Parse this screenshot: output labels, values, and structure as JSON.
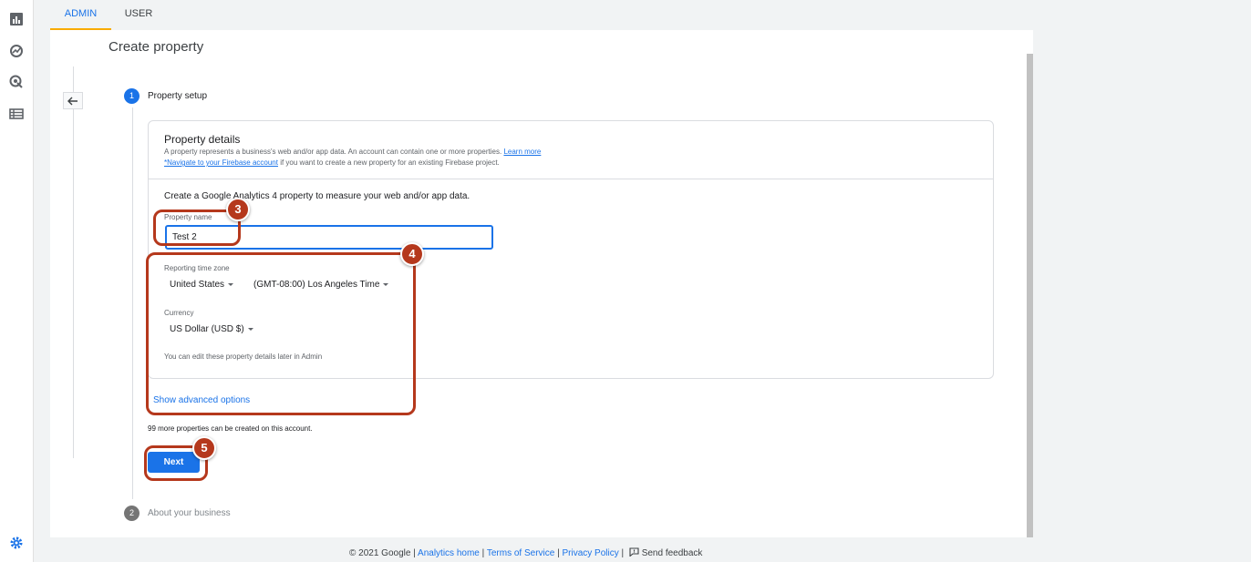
{
  "tabs": [
    {
      "label": "ADMIN"
    },
    {
      "label": "USER"
    }
  ],
  "page_title": "Create property",
  "steps": [
    {
      "number": "1",
      "label": "Property setup"
    },
    {
      "number": "2",
      "label": "About your business"
    }
  ],
  "details": {
    "title": "Property details",
    "desc_text": "A property represents a business's web and/or app data. An account can contain one or more properties.",
    "learn_more": "Learn more",
    "firebase_link": "*Navigate to your Firebase account",
    "firebase_rest": "if you want to create a new property for an existing Firebase project.",
    "intro": "Create a Google Analytics 4 property to measure your web and/or app data.",
    "property_name_label": "Property name",
    "property_name_value": "Test 2",
    "timezone_label": "Reporting time zone",
    "country": "United States",
    "timezone": "(GMT-08:00) Los Angeles Time",
    "currency_label": "Currency",
    "currency": "US Dollar (USD $)",
    "note": "You can edit these property details later in Admin"
  },
  "advanced_link": "Show advanced options",
  "remaining_text": "99 more properties can be created on this account.",
  "next_label": "Next",
  "callouts": [
    "3",
    "4",
    "5"
  ],
  "footer": {
    "copyright": "© 2021 Google |",
    "analytics_home": "Analytics home",
    "terms": "Terms of Service",
    "privacy": "Privacy Policy",
    "feedback": "Send feedback"
  },
  "colors": {
    "accent": "#1a73e8",
    "callout": "#b5381c",
    "tab_indicator": "#f9ab00"
  },
  "rail_icons": [
    "reports-icon",
    "explore-icon",
    "advertising-icon",
    "configure-icon",
    "admin-gear-icon"
  ]
}
